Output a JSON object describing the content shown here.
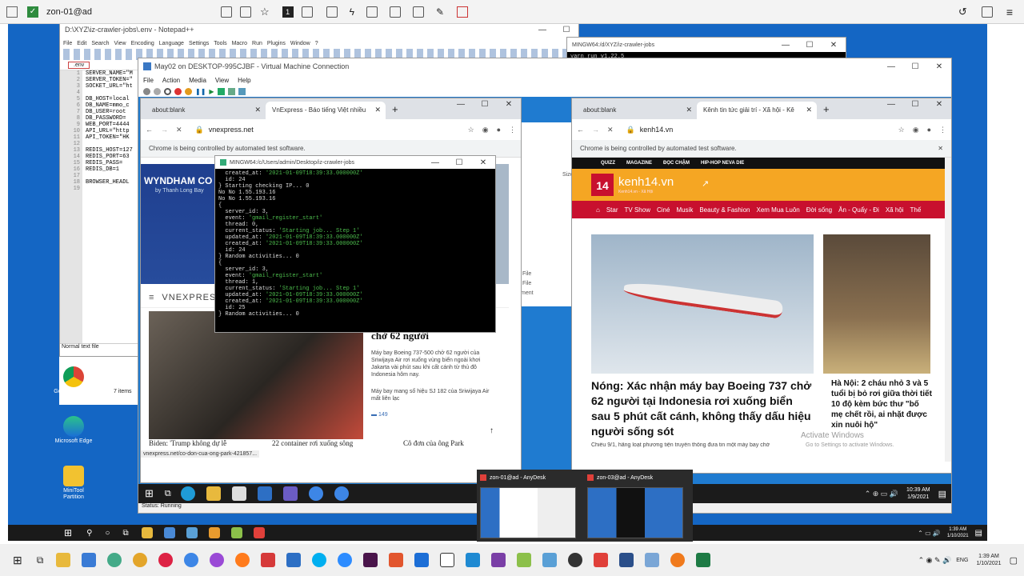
{
  "anydesk_bar": {
    "tab_label": "zon-01@ad"
  },
  "notepad": {
    "title": "D:\\XYZ\\iz-crawler-jobs\\.env - Notepad++",
    "menu": [
      "File",
      "Edit",
      "Search",
      "View",
      "Encoding",
      "Language",
      "Settings",
      "Tools",
      "Macro",
      "Run",
      "Plugins",
      "Window",
      "?"
    ],
    "tab": ".env",
    "lines": [
      "SERVER_NAME=\"M",
      "SERVER_TOKEN=\"",
      "SOCKET_URL=\"ht",
      "",
      "DB_HOST=local",
      "DB_NAME=mmo_c",
      "DB_USER=root",
      "DB_PASSWORD=",
      "WEB_PORT=4444",
      "API_URL=\"http",
      "API_TOKEN=\"HK",
      "",
      "REDIS_HOST=127",
      "REDIS_PORT=63",
      "REDIS_PASS=",
      "REDIS_DB=1",
      "",
      "BROWSER_HEADL"
    ],
    "line_numbers": [
      "1",
      "2",
      "3",
      "4",
      "5",
      "6",
      "7",
      "8",
      "9",
      "10",
      "11",
      "12",
      "13",
      "14",
      "15",
      "16",
      "17",
      "18",
      "19"
    ],
    "status": "Normal text file"
  },
  "mingw_top": {
    "title": "MINGW64:/d/XYZ/iz-crawler-jobs",
    "line": "yarn run v1.22.5"
  },
  "vm": {
    "title": "May02 on DESKTOP-995CJBF - Virtual Machine Connection",
    "menu": [
      "File",
      "Action",
      "Media",
      "View",
      "Help"
    ],
    "status": "Status: Running"
  },
  "explorer": {
    "items": "7 items",
    "labels": [
      "File",
      "File",
      "ment",
      "Size"
    ]
  },
  "chrome_left": {
    "tab1": "about:blank",
    "tab2": "VnExpress - Báo tiếng Việt nhiều",
    "url": "vnexpress.net",
    "infobar": "Chrome is being controlled by automated test software.",
    "ad_brand": "WYNDHAM CO",
    "ad_sub": "by Thanh Long Bay",
    "logo": "VNEXPRESS",
    "headline": "Rơi máy bay Indonesia chở 62 người",
    "summary": "Máy bay Boeing 737-500 chở 62 người của Sriwijaya Air rơi xuống vùng biển ngoài khơi Jakarta vài phút sau khi cất cánh từ thủ đô Indonesia hôm nay.",
    "related": "Máy bay mang số hiệu SJ 182 của Sriwijaya Air mất liên lạc",
    "comments": "149",
    "bottom_links": [
      "Biden: 'Trump không dự lễ",
      "22 container rơi xuống sông",
      "Cô đơn của ông Park"
    ],
    "status_url": "vnexpress.net/co-don-cua-ong-park-421857..."
  },
  "mingw_mid": {
    "title": "MINGW64:/c/Users/admin/Desktop/iz-crawler-jobs",
    "lines": [
      {
        "t": "  created_at: ",
        "v": "'2021-01-09T18:39:33.000000Z'"
      },
      {
        "t": "  id: 24",
        "v": ""
      },
      {
        "t": "} Starting checking IP... 0",
        "v": ""
      },
      {
        "t": "No No 1.55.193.16",
        "v": ""
      },
      {
        "t": "No No 1.55.193.16",
        "v": ""
      },
      {
        "t": "{",
        "v": ""
      },
      {
        "t": "  server_id: 3,",
        "v": ""
      },
      {
        "t": "  event: ",
        "v": "'gmail_register_start'"
      },
      {
        "t": "  thread: 0,",
        "v": ""
      },
      {
        "t": "  current_status: ",
        "v": "'Starting job... Step 1'"
      },
      {
        "t": "  updated_at: ",
        "v": "'2021-01-09T18:39:33.000000Z'"
      },
      {
        "t": "  created_at: ",
        "v": "'2021-01-09T18:39:33.000000Z'"
      },
      {
        "t": "  id: 24",
        "v": ""
      },
      {
        "t": "} Random activities... 0",
        "v": ""
      },
      {
        "t": "{",
        "v": ""
      },
      {
        "t": "  server_id: 3,",
        "v": ""
      },
      {
        "t": "  event: ",
        "v": "'gmail_register_start'"
      },
      {
        "t": "  thread: 1,",
        "v": ""
      },
      {
        "t": "  current_status: ",
        "v": "'Starting job... Step 1'"
      },
      {
        "t": "  updated_at: ",
        "v": "'2021-01-09T18:39:33.000000Z'"
      },
      {
        "t": "  created_at: ",
        "v": "'2021-01-09T18:39:33.000000Z'"
      },
      {
        "t": "  id: 25",
        "v": ""
      },
      {
        "t": "} Random activities... 0",
        "v": ""
      }
    ]
  },
  "chrome_right": {
    "tab1": "about:blank",
    "tab2": "Kênh tin tức giải trí - Xã hội - Kê",
    "url": "kenh14.vn",
    "infobar": "Chrome is being controlled by automated test software.",
    "topnav": [
      "QUIZZ",
      "MAGAZINE",
      "ĐỌC CHẬM",
      "HIP-HOP NEVA DIE"
    ],
    "logo": "kenh14.vn",
    "logo_sub": "Kenh14.vn - Xã Hội",
    "nav": [
      "Star",
      "TV Show",
      "Ciné",
      "Musik",
      "Beauty & Fashion",
      "Xem Mua Luôn",
      "Đời sống",
      "Ăn - Quẩy - Đi",
      "Xã hội",
      "Thế"
    ],
    "headline": "Nóng: Xác nhận máy bay Boeing 737 chở 62 người tại Indonesia rơi xuống biển sau 5 phút cất cánh, không thấy dấu hiệu người sống sót",
    "side_headline": "Hà Nội: 2 cháu nhỏ 3 và 5 tuổi bị bỏ rơi giữa thời tiết 10 độ kèm bức thư \"bố mẹ chết rồi, ai nhặt được xin nuôi hộ\"",
    "summary": "Chiều 9/1, hãng loạt phương tiện truyền thông đưa tin một máy bay chở",
    "activate": "Activate Windows",
    "activate_sub": "Go to Settings to activate Windows."
  },
  "desktop_icons": [
    "Google Chrome",
    "Microsoft Edge",
    "MiniTool Partition"
  ],
  "vm_clock": {
    "time": "10:39 AM",
    "date": "1/9/2021"
  },
  "remote_clock": {
    "time": "1:39 AM",
    "date": "1/10/2021"
  },
  "host_clock": {
    "time": "1:39 AM",
    "date": "1/10/2021",
    "lang": "ENG"
  },
  "anydesk_previews": [
    {
      "label": "zon-01@ad - AnyDesk"
    },
    {
      "label": "zon-03@ad - AnyDesk"
    }
  ],
  "colors": {
    "desktop": "#1466c4",
    "kenh_orange": "#f5a623",
    "kenh_red": "#c8102e",
    "chrome_tab": "#dee1e6",
    "terminal": "#000000"
  }
}
